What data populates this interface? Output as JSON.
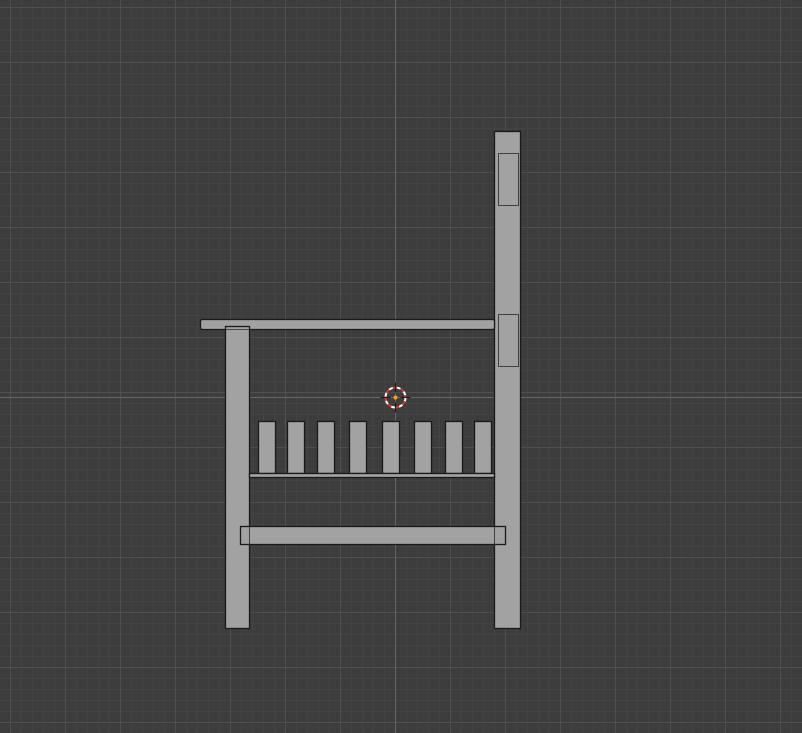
{
  "viewport": {
    "view": "side-orthographic",
    "grid": true,
    "colors": {
      "background": "#3d3d3d",
      "grid_line": "#505050",
      "axis_x": "#b04848",
      "axis_z": "#3c6fa0",
      "mesh_fill": "#a2a2a2",
      "mesh_edge": "#1a1a1a",
      "cursor_red": "#e0302a",
      "cursor_white": "#ffffff"
    }
  },
  "scene": {
    "object": "chair",
    "slat_count": 8,
    "cursor_icon": "3d-cursor-icon"
  }
}
